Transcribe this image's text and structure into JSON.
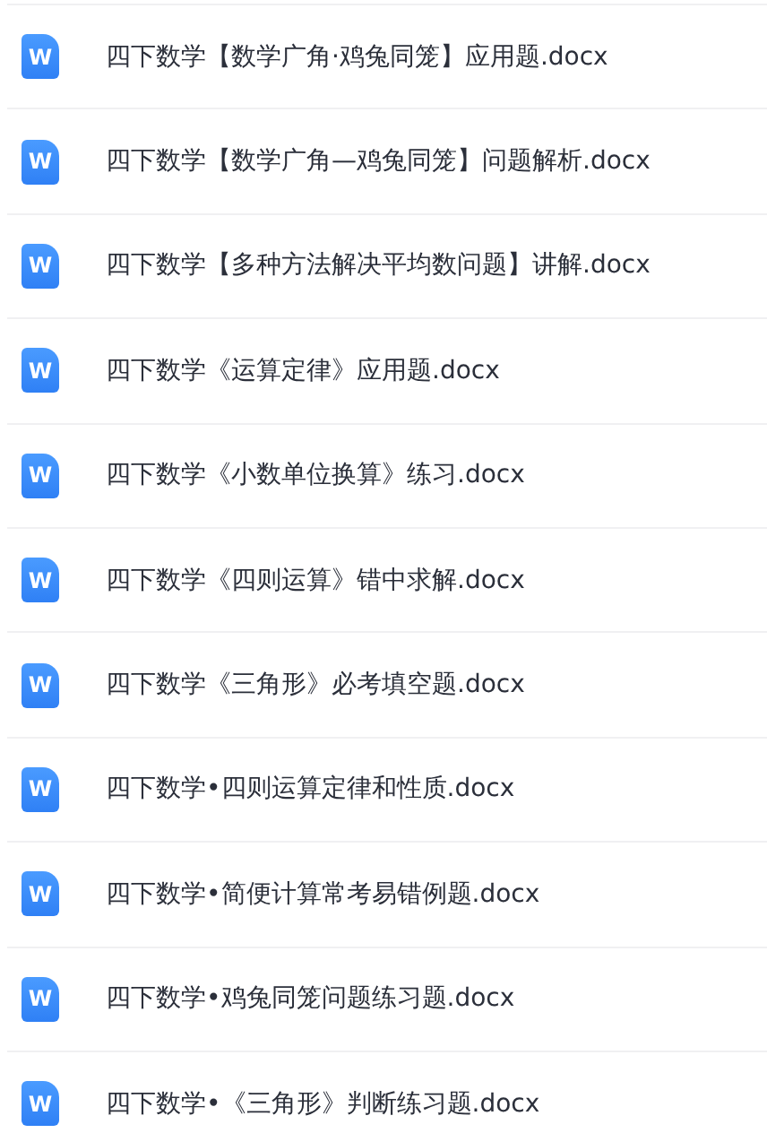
{
  "files": [
    {
      "icon": "W",
      "name": "四下数学【数学广角·鸡兔同笼】应用题.docx"
    },
    {
      "icon": "W",
      "name": "四下数学【数学广角—鸡兔同笼】问题解析.docx"
    },
    {
      "icon": "W",
      "name": "四下数学【多种方法解决平均数问题】讲解.docx"
    },
    {
      "icon": "W",
      "name": "四下数学《运算定律》应用题.docx"
    },
    {
      "icon": "W",
      "name": "四下数学《小数单位换算》练习.docx"
    },
    {
      "icon": "W",
      "name": "四下数学《四则运算》错中求解.docx"
    },
    {
      "icon": "W",
      "name": "四下数学《三角形》必考填空题.docx"
    },
    {
      "icon": "W",
      "name": "四下数学•四则运算定律和性质.docx"
    },
    {
      "icon": "W",
      "name": "四下数学•简便计算常考易错例题.docx"
    },
    {
      "icon": "W",
      "name": "四下数学•鸡兔同笼问题练习题.docx"
    },
    {
      "icon": "W",
      "name": "四下数学•《三角形》判断练习题.docx"
    }
  ]
}
